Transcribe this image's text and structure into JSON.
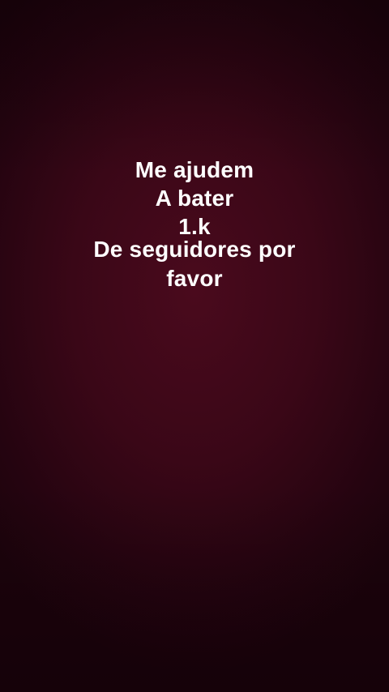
{
  "story": {
    "lines": [
      "Me ajudem",
      "A bater",
      "1.k",
      "De seguidores por",
      "favor"
    ],
    "background_color": "#3a0717",
    "text_color": "#ffffff"
  }
}
